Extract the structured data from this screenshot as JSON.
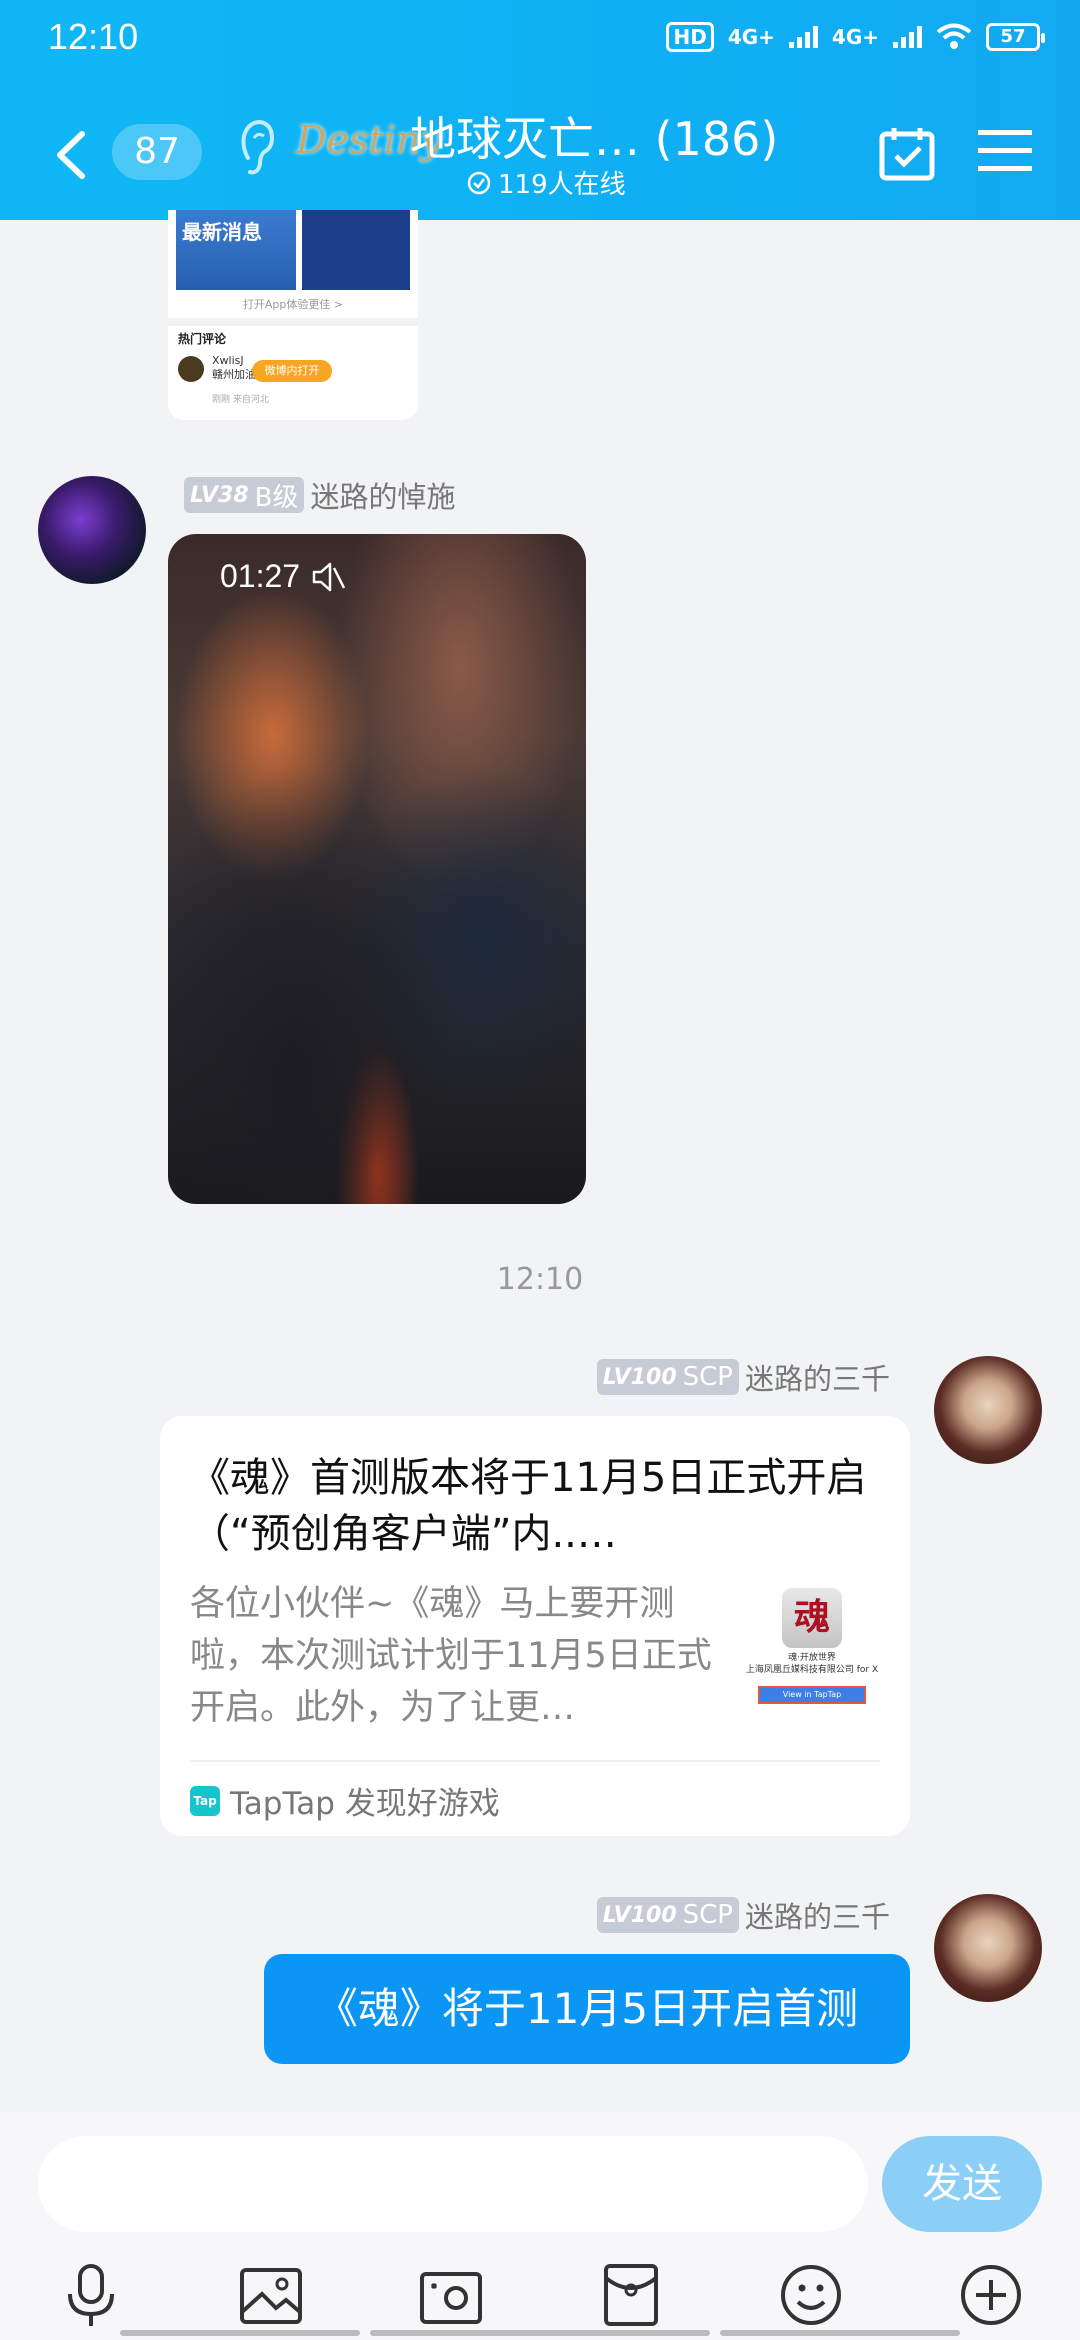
{
  "status": {
    "time": "12:10",
    "network1": "4G+",
    "network2": "4G+",
    "hd": "HD",
    "battery": "57"
  },
  "header": {
    "back_count": "87",
    "logo_text": "Destiny",
    "title": "地球灭亡…  (186)",
    "online": "119人在线"
  },
  "top_card": {
    "banner": "最新消息",
    "open_app": "打开App体验更佳 >",
    "hot": "热门评论",
    "user": "XwlisJ",
    "sub": "赣州加油",
    "btn": "微博内打开",
    "time": "刚刚 来自河北"
  },
  "messages": [
    {
      "level": "LV38",
      "title": "B级",
      "name": "迷路的悼施",
      "video_duration": "01:27"
    },
    {
      "level": "LV100",
      "title": "SCP",
      "name": "迷路的三千",
      "card": {
        "title": "《魂》首测版本将于11月5日正式开启（“预创角客户端”内..…",
        "desc": "各位小伙伴~《魂》马上要开测啦，本次测试计划于11月5日正式开启。此外，为了让更…",
        "thumb_icon": "魂",
        "thumb_title": "魂·开放世界",
        "thumb_company": "上海凤凰丘媒科技有限公司 for X",
        "thumb_btn": "View in TapTap",
        "source": "TapTap 发现好游戏",
        "source_icon": "Tap"
      }
    },
    {
      "level": "LV100",
      "title": "SCP",
      "name": "迷路的三千",
      "text": "《魂》将于11月5日开启首测"
    }
  ],
  "timestamp": "12:10",
  "input": {
    "placeholder": "",
    "send": "发送"
  },
  "colors": {
    "header": "#10b7f5",
    "bubble": "#0b96f6",
    "send": "#8ccff6"
  }
}
